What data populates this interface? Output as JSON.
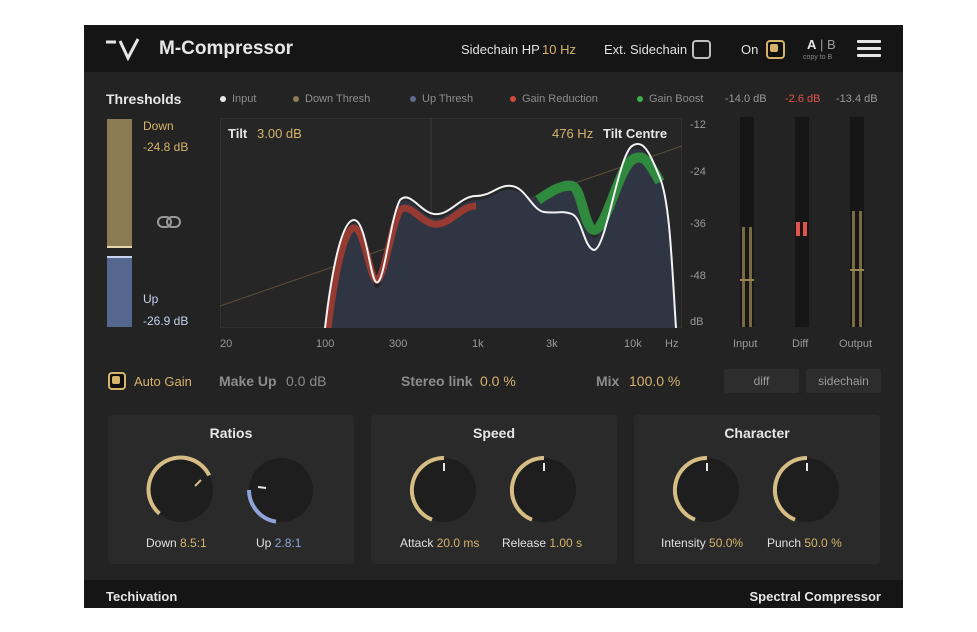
{
  "header": {
    "brand": "M-Compressor",
    "sidechain_hp_label": "Sidechain HP",
    "sidechain_hp_value": "10 Hz",
    "ext_sidechain_label": "Ext. Sidechain",
    "on_label": "On",
    "ab_a": "A",
    "ab_sep": " | ",
    "ab_b": "B",
    "ab_sub": "copy to B"
  },
  "thresholds": {
    "title": "Thresholds",
    "down_label": "Down",
    "down_value": "-24.8 dB",
    "up_label": "Up",
    "up_value": "-26.9 dB"
  },
  "legend": [
    {
      "label": "Input",
      "color": "#e8e8e8"
    },
    {
      "label": "Down Thresh",
      "color": "#8a7b55"
    },
    {
      "label": "Up Thresh",
      "color": "#5e6a8c"
    },
    {
      "label": "Gain Reduction",
      "color": "#d04a3a"
    },
    {
      "label": "Gain Boost",
      "color": "#3fb04a"
    }
  ],
  "graph": {
    "tilt_label": "Tilt",
    "tilt_value": "3.00 dB",
    "centre_value": "476 Hz",
    "centre_label": "Tilt Centre",
    "freq_ticks": [
      "20",
      "100",
      "300",
      "1k",
      "3k",
      "10k",
      "Hz"
    ],
    "db_ticks": [
      "-12",
      "-24",
      "-36",
      "-48",
      "dB"
    ]
  },
  "meters": {
    "input_db": "-14.0 dB",
    "diff_db": "-2.6 dB",
    "output_db": "-13.4 dB",
    "input_label": "Input",
    "diff_label": "Diff",
    "output_label": "Output"
  },
  "controls": {
    "auto_gain_label": "Auto Gain",
    "makeup_label": "Make Up",
    "makeup_value": "0.0 dB",
    "stereo_label": "Stereo link",
    "stereo_value": "0.0 %",
    "mix_label": "Mix",
    "mix_value": "100.0 %",
    "diff_button": "diff",
    "sidechain_button": "sidechain"
  },
  "ratios": {
    "title": "Ratios",
    "down_label": "Down",
    "down_value": "8.5:1",
    "up_label": "Up",
    "up_value": "2.8:1"
  },
  "speed": {
    "title": "Speed",
    "attack_label": "Attack",
    "attack_value": "20.0 ms",
    "release_label": "Release",
    "release_value": "1.00 s"
  },
  "character": {
    "title": "Character",
    "intensity_label": "Intensity",
    "intensity_value": "50.0%",
    "punch_label": "Punch",
    "punch_value": "50.0 %"
  },
  "footer": {
    "left": "Techivation",
    "right": "Spectral Compressor"
  },
  "colors": {
    "accent": "#d6b36a",
    "up_blue": "#8fa3d8",
    "diff_red": "#e0554a"
  }
}
